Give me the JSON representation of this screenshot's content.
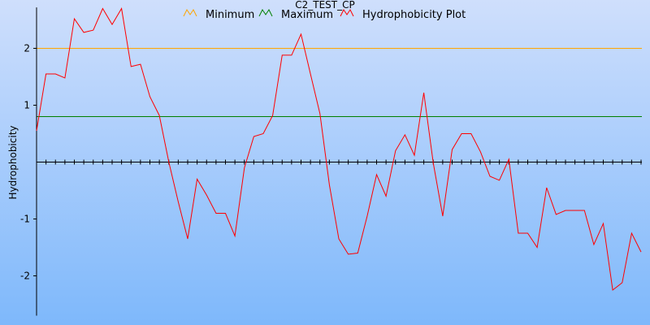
{
  "chart_data": {
    "type": "line",
    "title": "C2_TEST_CP",
    "ylabel": "Hydrophobicity",
    "xlabel": "",
    "ylim": [
      -2.7,
      2.72
    ],
    "yticks": [
      2,
      1,
      -1,
      -2
    ],
    "ytick_labels": [
      "2",
      "1",
      "-1",
      "-2"
    ],
    "grid": false,
    "legend_position": "top-center",
    "colors": {
      "minimum": "#ffa500",
      "maximum": "#008000",
      "plot": "#ff0000",
      "background_top": "#cfdffc",
      "background_bottom": "#7eb8fb"
    },
    "reference_lines": [
      {
        "name": "Minimum",
        "value": 2.0
      },
      {
        "name": "Maximum",
        "value": 0.8
      }
    ],
    "series": [
      {
        "name": "Hydrophobicity Plot",
        "values": [
          0.55,
          1.55,
          1.55,
          1.48,
          2.52,
          2.28,
          2.32,
          2.7,
          2.42,
          2.7,
          1.68,
          1.72,
          1.15,
          0.82,
          0.0,
          -0.7,
          -1.35,
          -0.3,
          -0.58,
          -0.9,
          -0.9,
          -1.3,
          -0.1,
          0.45,
          0.5,
          0.82,
          1.88,
          1.88,
          2.25,
          1.55,
          0.85,
          -0.4,
          -1.35,
          -1.62,
          -1.6,
          -0.95,
          -0.22,
          -0.6,
          0.2,
          0.48,
          0.12,
          1.22,
          -0.02,
          -0.95,
          0.22,
          0.5,
          0.5,
          0.18,
          -0.25,
          -0.32,
          0.05,
          -1.25,
          -1.25,
          -1.5,
          -0.45,
          -0.92,
          -0.85,
          -0.85,
          -0.85,
          -1.45,
          -1.08,
          -2.25,
          -2.12,
          -1.25,
          -1.58
        ]
      }
    ]
  }
}
